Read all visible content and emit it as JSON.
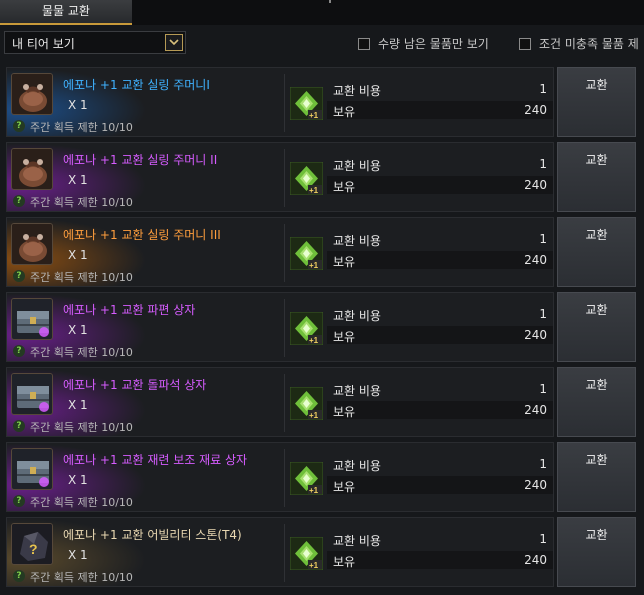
{
  "tabs": {
    "active_label": "물물 교환"
  },
  "filters": {
    "dropdown_value": "내 티어 보기",
    "checkbox1_label": "수량 남은 물품만 보기",
    "checkbox2_label": "조건 미충족 물품 제"
  },
  "items": [
    {
      "name": "에포나 +1 교환 실링 주머니I",
      "qty": "X 1",
      "limit": "주간 획득 제한 10/10",
      "cost_label": "교환 비용",
      "cost": "1",
      "own_label": "보유",
      "own": "240",
      "button": "교환",
      "color": "#3fb2ff",
      "glow": "#1d4f8a",
      "icon": "pouch-icon"
    },
    {
      "name": "에포나 +1 교환 실링 주머니 II",
      "qty": "X 1",
      "limit": "주간 획득 제한 10/10",
      "cost_label": "교환 비용",
      "cost": "1",
      "own_label": "보유",
      "own": "240",
      "button": "교환",
      "color": "#d65cff",
      "glow": "#6a1f8a",
      "icon": "pouch-icon"
    },
    {
      "name": "에포나 +1 교환 실링 주머니 III",
      "qty": "X 1",
      "limit": "주간 획득 제한 10/10",
      "cost_label": "교환 비용",
      "cost": "1",
      "own_label": "보유",
      "own": "240",
      "button": "교환",
      "color": "#ff9e3d",
      "glow": "#8a4e12",
      "icon": "pouch-icon"
    },
    {
      "name": "에포나 +1 교환 파편 상자",
      "qty": "X 1",
      "limit": "주간 획득 제한 10/10",
      "cost_label": "교환 비용",
      "cost": "1",
      "own_label": "보유",
      "own": "240",
      "button": "교환",
      "color": "#d65cff",
      "glow": "#6a1f8a",
      "icon": "chest-icon"
    },
    {
      "name": "에포나 +1 교환 돌파석 상자",
      "qty": "X 1",
      "limit": "주간 획득 제한 10/10",
      "cost_label": "교환 비용",
      "cost": "1",
      "own_label": "보유",
      "own": "240",
      "button": "교환",
      "color": "#d65cff",
      "glow": "#6a1f8a",
      "icon": "chest-icon"
    },
    {
      "name": "에포나 +1 교환 재련 보조 재료 상자",
      "qty": "X 1",
      "limit": "주간 획득 제한 10/10",
      "cost_label": "교환 비용",
      "cost": "1",
      "own_label": "보유",
      "own": "240",
      "button": "교환",
      "color": "#d65cff",
      "glow": "#6a1f8a",
      "icon": "chest-icon"
    },
    {
      "name": "에포나 +1 교환 어빌리티 스톤(T4)",
      "qty": "X 1",
      "limit": "주간 획득 제한 10/10",
      "cost_label": "교환 비용",
      "cost": "1",
      "own_label": "보유",
      "own": "240",
      "button": "교환",
      "color": "#e9d8b2",
      "glow": "#5a4a2c",
      "icon": "stone-icon"
    }
  ]
}
